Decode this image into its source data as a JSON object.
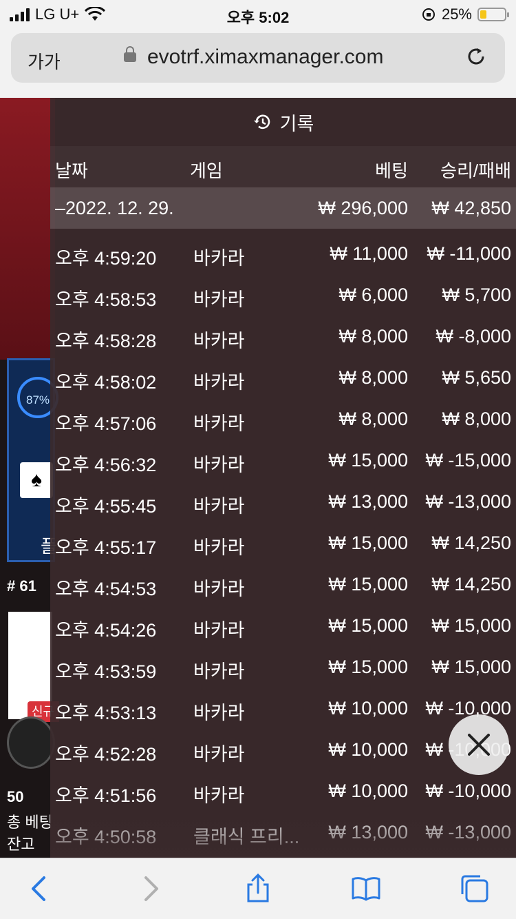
{
  "status_bar": {
    "carrier": "LG U+",
    "time": "오후 5:02",
    "battery_percent": "25%",
    "battery_level": 0.25
  },
  "browser": {
    "text_size_label": "가가",
    "url": "evotrf.ximaxmanager.com"
  },
  "background": {
    "progress_label": "87%",
    "table_number": "# 61",
    "new_tag": "신규",
    "players": "50",
    "total_bet_label": "총 베팅",
    "balance_label": "잔고"
  },
  "history": {
    "title": "기록",
    "columns": {
      "date": "날짜",
      "game": "게임",
      "bet": "베팅",
      "win_loss": "승리/패배"
    },
    "date_group": {
      "date": "–2022. 12. 29.",
      "bet_total": "₩ 296,000",
      "win_total": "₩ 42,850"
    },
    "rows": [
      {
        "time": "오후 4:59:20",
        "game": "바카라",
        "bet": "₩ 11,000",
        "result": "₩ -11,000"
      },
      {
        "time": "오후 4:58:53",
        "game": "바카라",
        "bet": "₩ 6,000",
        "result": "₩ 5,700"
      },
      {
        "time": "오후 4:58:28",
        "game": "바카라",
        "bet": "₩ 8,000",
        "result": "₩ -8,000"
      },
      {
        "time": "오후 4:58:02",
        "game": "바카라",
        "bet": "₩ 8,000",
        "result": "₩ 5,650"
      },
      {
        "time": "오후 4:57:06",
        "game": "바카라",
        "bet": "₩ 8,000",
        "result": "₩ 8,000"
      },
      {
        "time": "오후 4:56:32",
        "game": "바카라",
        "bet": "₩ 15,000",
        "result": "₩ -15,000"
      },
      {
        "time": "오후 4:55:45",
        "game": "바카라",
        "bet": "₩ 13,000",
        "result": "₩ -13,000"
      },
      {
        "time": "오후 4:55:17",
        "game": "바카라",
        "bet": "₩ 15,000",
        "result": "₩ 14,250"
      },
      {
        "time": "오후 4:54:53",
        "game": "바카라",
        "bet": "₩ 15,000",
        "result": "₩ 14,250"
      },
      {
        "time": "오후 4:54:26",
        "game": "바카라",
        "bet": "₩ 15,000",
        "result": "₩ 15,000"
      },
      {
        "time": "오후 4:53:59",
        "game": "바카라",
        "bet": "₩ 15,000",
        "result": "₩ 15,000"
      },
      {
        "time": "오후 4:53:13",
        "game": "바카라",
        "bet": "₩ 10,000",
        "result": "₩ -10,000"
      },
      {
        "time": "오후 4:52:28",
        "game": "바카라",
        "bet": "₩ 10,000",
        "result": "₩ -10,000"
      },
      {
        "time": "오후 4:51:56",
        "game": "바카라",
        "bet": "₩ 10,000",
        "result": "₩ -10,000"
      },
      {
        "time": "오후 4:50:58",
        "game": "클래식 프리...",
        "bet": "₩ 13,000",
        "result": "₩ -13,000"
      }
    ]
  },
  "icons": {
    "history": "history-icon",
    "close": "close-icon",
    "back": "chevron-left-icon",
    "forward": "chevron-right-icon",
    "share": "share-icon",
    "bookmarks": "book-icon",
    "tabs": "tabs-icon",
    "reload": "reload-icon",
    "lock": "lock-icon"
  }
}
